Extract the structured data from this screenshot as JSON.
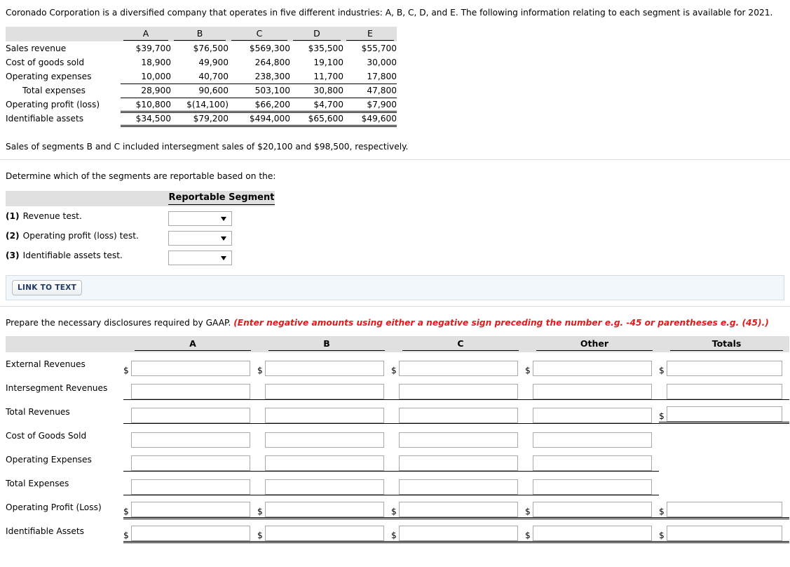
{
  "intro": "Coronado Corporation is a diversified company that operates in five different industries: A, B, C, D, and E. The following information relating to each segment is available for 2021.",
  "segment_table": {
    "columns": [
      "A",
      "B",
      "C",
      "D",
      "E"
    ],
    "rows": [
      {
        "label": "Sales revenue",
        "values": [
          "$39,700",
          "$76,500",
          "$569,300",
          "$35,500",
          "$55,700"
        ],
        "rule": "none",
        "indent": false
      },
      {
        "label": "Cost of goods sold",
        "values": [
          "18,900",
          "49,900",
          "264,800",
          "19,100",
          "30,000"
        ],
        "rule": "none",
        "indent": false
      },
      {
        "label": "Operating expenses",
        "values": [
          "10,000",
          "40,700",
          "238,300",
          "11,700",
          "17,800"
        ],
        "rule": "single",
        "indent": false
      },
      {
        "label": "Total expenses",
        "values": [
          "28,900",
          "90,600",
          "503,100",
          "30,800",
          "47,800"
        ],
        "rule": "single",
        "indent": true
      },
      {
        "label": "Operating profit (loss)",
        "values": [
          "$10,800",
          "$(14,100)",
          "$66,200",
          "$4,700",
          "$7,900"
        ],
        "rule": "double",
        "indent": false
      },
      {
        "label": "Identifiable assets",
        "values": [
          "$34,500",
          "$79,200",
          "$494,000",
          "$65,600",
          "$49,600"
        ],
        "rule": "double",
        "indent": false
      }
    ],
    "footnote": "Sales of segments B and C included intersegment sales of $20,100 and $98,500, respectively."
  },
  "reportable": {
    "prompt": "Determine which of the segments are reportable based on the:",
    "column_header": "Reportable Segment",
    "questions": [
      {
        "num": "(1)",
        "text": "Revenue test.",
        "value": ""
      },
      {
        "num": "(2)",
        "text": "Operating profit (loss) test.",
        "value": ""
      },
      {
        "num": "(3)",
        "text": "Identifiable assets test.",
        "value": ""
      }
    ],
    "link_button_label": "LINK TO TEXT"
  },
  "disclosures": {
    "prompt_plain": "Prepare the necessary disclosures required by GAAP. ",
    "prompt_italic": "(Enter negative amounts using either a negative sign preceding the number e.g. -45 or parentheses e.g. (45).)",
    "prompt_italic_color": "#e01b1b",
    "columns": [
      "A",
      "B",
      "C",
      "Other",
      "Totals"
    ],
    "rows": [
      {
        "label": "External Revenues",
        "cells": [
          {
            "dollar": "$",
            "rule": "none",
            "input": true
          },
          {
            "dollar": "$",
            "rule": "none",
            "input": true
          },
          {
            "dollar": "$",
            "rule": "none",
            "input": true
          },
          {
            "dollar": "$",
            "rule": "none",
            "input": true
          },
          {
            "dollar": "$",
            "rule": "none",
            "input": true
          }
        ]
      },
      {
        "label": "Intersegment Revenues",
        "cells": [
          {
            "dollar": "",
            "rule": "single",
            "input": true
          },
          {
            "dollar": "",
            "rule": "single",
            "input": true
          },
          {
            "dollar": "",
            "rule": "single",
            "input": true
          },
          {
            "dollar": "",
            "rule": "single",
            "input": true
          },
          {
            "dollar": "",
            "rule": "single",
            "input": true
          }
        ]
      },
      {
        "label": "Total Revenues",
        "cells": [
          {
            "dollar": "",
            "rule": "single",
            "input": true
          },
          {
            "dollar": "",
            "rule": "single",
            "input": true
          },
          {
            "dollar": "",
            "rule": "single",
            "input": true
          },
          {
            "dollar": "",
            "rule": "single",
            "input": true
          },
          {
            "dollar": "$",
            "rule": "double",
            "input": true
          }
        ]
      },
      {
        "label": "Cost of Goods Sold",
        "cells": [
          {
            "dollar": "",
            "rule": "none",
            "input": true
          },
          {
            "dollar": "",
            "rule": "none",
            "input": true
          },
          {
            "dollar": "",
            "rule": "none",
            "input": true
          },
          {
            "dollar": "",
            "rule": "none",
            "input": true
          },
          {
            "dollar": "",
            "rule": "none",
            "input": false
          }
        ]
      },
      {
        "label": "Operating Expenses",
        "cells": [
          {
            "dollar": "",
            "rule": "single",
            "input": true
          },
          {
            "dollar": "",
            "rule": "single",
            "input": true
          },
          {
            "dollar": "",
            "rule": "single",
            "input": true
          },
          {
            "dollar": "",
            "rule": "single",
            "input": true
          },
          {
            "dollar": "",
            "rule": "none",
            "input": false
          }
        ]
      },
      {
        "label": "Total Expenses",
        "cells": [
          {
            "dollar": "",
            "rule": "single",
            "input": true
          },
          {
            "dollar": "",
            "rule": "single",
            "input": true
          },
          {
            "dollar": "",
            "rule": "single",
            "input": true
          },
          {
            "dollar": "",
            "rule": "single",
            "input": true
          },
          {
            "dollar": "",
            "rule": "none",
            "input": false
          }
        ]
      },
      {
        "label": "Operating Profit (Loss)",
        "cells": [
          {
            "dollar": "$",
            "rule": "double",
            "input": true
          },
          {
            "dollar": "$",
            "rule": "double",
            "input": true
          },
          {
            "dollar": "$",
            "rule": "double",
            "input": true
          },
          {
            "dollar": "$",
            "rule": "double",
            "input": true
          },
          {
            "dollar": "$",
            "rule": "double",
            "input": true
          }
        ]
      },
      {
        "label": "Identifiable Assets",
        "cells": [
          {
            "dollar": "$",
            "rule": "double",
            "input": true
          },
          {
            "dollar": "$",
            "rule": "double",
            "input": true
          },
          {
            "dollar": "$",
            "rule": "double",
            "input": true
          },
          {
            "dollar": "$",
            "rule": "double",
            "input": true
          },
          {
            "dollar": "$",
            "rule": "double",
            "input": true
          }
        ]
      }
    ]
  }
}
